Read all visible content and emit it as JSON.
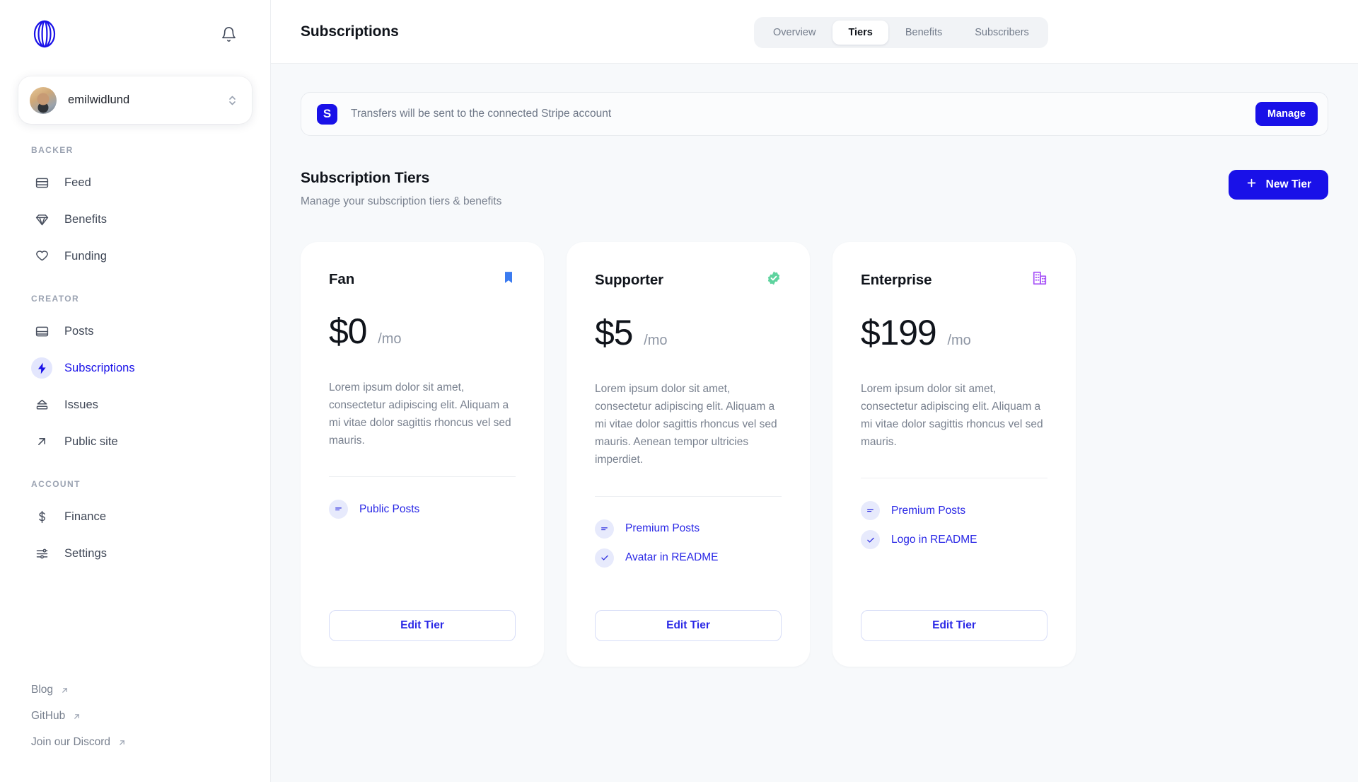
{
  "sidebar": {
    "logo_icon": "polar-logo-icon",
    "notifications_icon": "bell-icon",
    "profile": {
      "username": "emilwidlund",
      "switcher_icon": "chevron-up-down-icon"
    },
    "groups": [
      {
        "label": "Backer",
        "items": [
          {
            "label": "Feed",
            "icon": "feed-icon",
            "active": false
          },
          {
            "label": "Benefits",
            "icon": "diamond-icon",
            "active": false
          },
          {
            "label": "Funding",
            "icon": "heart-icon",
            "active": false
          }
        ]
      },
      {
        "label": "Creator",
        "items": [
          {
            "label": "Posts",
            "icon": "posts-icon",
            "active": false
          },
          {
            "label": "Subscriptions",
            "icon": "bolt-icon",
            "active": true
          },
          {
            "label": "Issues",
            "icon": "issues-icon",
            "active": false
          },
          {
            "label": "Public site",
            "icon": "external-link-icon",
            "active": false
          }
        ]
      },
      {
        "label": "Account",
        "items": [
          {
            "label": "Finance",
            "icon": "dollar-icon",
            "active": false
          },
          {
            "label": "Settings",
            "icon": "sliders-icon",
            "active": false
          }
        ]
      }
    ],
    "footer_links": [
      {
        "label": "Blog",
        "icon": "external-link-icon"
      },
      {
        "label": "GitHub",
        "icon": "external-link-icon"
      },
      {
        "label": "Join our Discord",
        "icon": "external-link-icon"
      }
    ]
  },
  "header": {
    "title": "Subscriptions",
    "tabs": [
      {
        "label": "Overview",
        "active": false
      },
      {
        "label": "Tiers",
        "active": true
      },
      {
        "label": "Benefits",
        "active": false
      },
      {
        "label": "Subscribers",
        "active": false
      }
    ]
  },
  "banner": {
    "logo_text": "S",
    "message": "Transfers will be sent to the connected Stripe account",
    "action_label": "Manage"
  },
  "section": {
    "title": "Subscription Tiers",
    "subtitle": "Manage your subscription tiers & benefits",
    "new_tier_label": "New Tier",
    "new_tier_icon": "plus-icon"
  },
  "colors": {
    "accent": "#1911e8",
    "link": "#2a28e6",
    "tier_fan": "#3b7bf0",
    "tier_supporter": "#5ed39e",
    "tier_enterprise": "#a855f7"
  },
  "tiers": [
    {
      "name": "Fan",
      "icon": "bookmark-icon",
      "icon_color": "#3b7bf0",
      "price": "$0",
      "period": "/mo",
      "description": "Lorem ipsum dolor sit amet, consectetur adipiscing elit. Aliquam a mi vitae dolor sagittis rhoncus vel sed mauris.",
      "benefits": [
        {
          "label": "Public Posts",
          "icon": "articles-icon"
        }
      ],
      "edit_label": "Edit Tier"
    },
    {
      "name": "Supporter",
      "icon": "verified-badge-icon",
      "icon_color": "#5ed39e",
      "price": "$5",
      "period": "/mo",
      "description": "Lorem ipsum dolor sit amet, consectetur adipiscing elit. Aliquam a mi vitae dolor sagittis rhoncus vel sed mauris. Aenean tempor ultricies imperdiet.",
      "benefits": [
        {
          "label": "Premium Posts",
          "icon": "articles-icon"
        },
        {
          "label": "Avatar in README",
          "icon": "check-icon"
        }
      ],
      "edit_label": "Edit Tier"
    },
    {
      "name": "Enterprise",
      "icon": "building-icon",
      "icon_color": "#a855f7",
      "price": "$199",
      "period": "/mo",
      "description": "Lorem ipsum dolor sit amet, consectetur adipiscing elit. Aliquam a mi vitae dolor sagittis rhoncus vel sed mauris.",
      "benefits": [
        {
          "label": "Premium Posts",
          "icon": "articles-icon"
        },
        {
          "label": "Logo in README",
          "icon": "check-icon"
        }
      ],
      "edit_label": "Edit Tier"
    }
  ]
}
